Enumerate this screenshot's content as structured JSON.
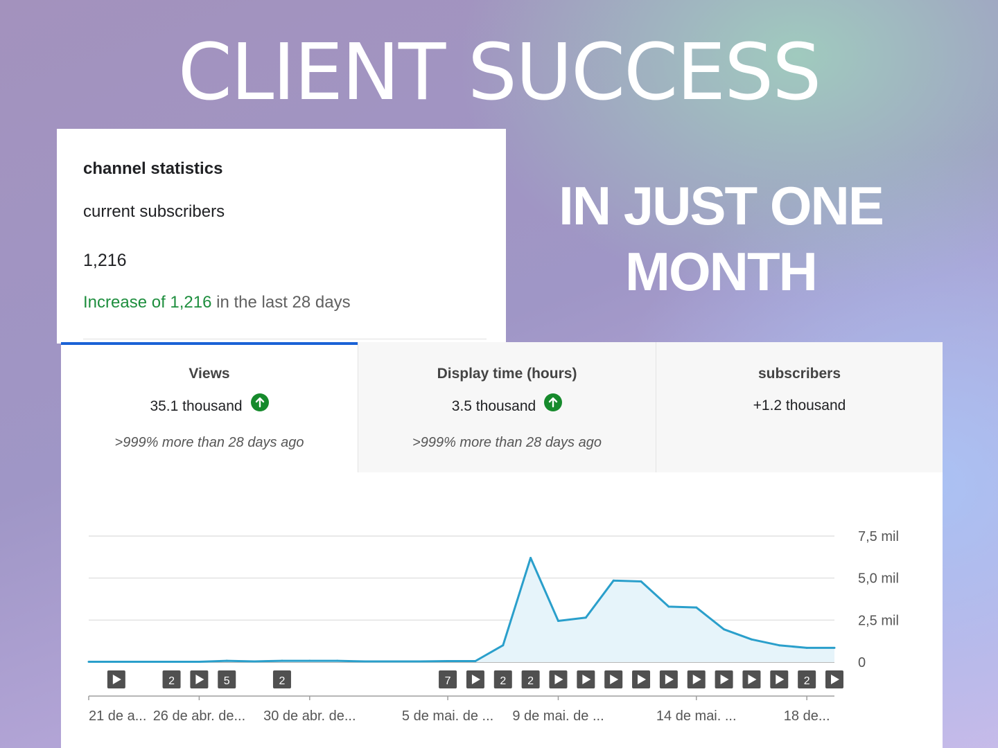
{
  "hero": {
    "title": "CLIENT SUCCESS",
    "subtitle_line1": "IN JUST ONE",
    "subtitle_line2": "MONTH"
  },
  "stats_card": {
    "heading": "channel statistics",
    "label": "current subscribers",
    "count": "1,216",
    "change_highlight": "Increase of 1,216",
    "change_rest": " in the last 28 days"
  },
  "tabs": [
    {
      "title": "Views",
      "value": "35.1 thousand",
      "trend_icon": "arrow-up-circle-icon",
      "note": ">999% more than 28 days ago"
    },
    {
      "title": "Display time (hours)",
      "value": "3.5 thousand",
      "trend_icon": "arrow-up-circle-icon",
      "note": ">999% more than 28 days ago"
    },
    {
      "title": "subscribers",
      "value": "+1.2 thousand"
    }
  ],
  "colors": {
    "accent": "#1a62d6",
    "positive": "#1e8e3e",
    "line": "#2a9fcb",
    "area": "#e6f4fa"
  },
  "chart_data": {
    "type": "area",
    "x": [
      "21 abr",
      "22 abr",
      "23 abr",
      "24 abr",
      "25 abr",
      "26 abr",
      "27 abr",
      "28 abr",
      "29 abr",
      "30 abr",
      "1 mai",
      "2 mai",
      "3 mai",
      "4 mai",
      "5 mai",
      "6 mai",
      "7 mai",
      "8 mai",
      "9 mai",
      "10 mai",
      "11 mai",
      "12 mai",
      "13 mai",
      "14 mai",
      "15 mai",
      "16 mai",
      "17 mai",
      "18 mai"
    ],
    "values": [
      20,
      20,
      20,
      20,
      20,
      80,
      40,
      80,
      80,
      80,
      40,
      40,
      40,
      60,
      60,
      1000,
      6200,
      2450,
      2650,
      4850,
      4800,
      3300,
      3250,
      1950,
      1350,
      1000,
      850,
      850
    ],
    "y_ticks": [
      "7,5 mil",
      "5,0 mil",
      "2,5 mil",
      "0"
    ],
    "y_tick_values": [
      7500,
      5000,
      2500,
      0
    ],
    "ylim": [
      0,
      7500
    ],
    "x_tick_labels": [
      {
        "index": 0,
        "label": "21 de a..."
      },
      {
        "index": 4,
        "label": "26 de abr. de..."
      },
      {
        "index": 8,
        "label": "30 de abr. de..."
      },
      {
        "index": 13,
        "label": "5 de mai. de ..."
      },
      {
        "index": 17,
        "label": "9 de mai. de ..."
      },
      {
        "index": 22,
        "label": "14 de mai. ..."
      },
      {
        "index": 26,
        "label": "18 de..."
      }
    ],
    "markers": [
      {
        "index": 1,
        "kind": "play"
      },
      {
        "index": 3,
        "kind": "count",
        "label": "2"
      },
      {
        "index": 4,
        "kind": "play"
      },
      {
        "index": 5,
        "kind": "count",
        "label": "5"
      },
      {
        "index": 7,
        "kind": "count",
        "label": "2"
      },
      {
        "index": 13,
        "kind": "count",
        "label": "7"
      },
      {
        "index": 14,
        "kind": "play"
      },
      {
        "index": 15,
        "kind": "count",
        "label": "2"
      },
      {
        "index": 16,
        "kind": "count",
        "label": "2"
      },
      {
        "index": 17,
        "kind": "play"
      },
      {
        "index": 18,
        "kind": "play"
      },
      {
        "index": 19,
        "kind": "play"
      },
      {
        "index": 20,
        "kind": "play"
      },
      {
        "index": 21,
        "kind": "play"
      },
      {
        "index": 22,
        "kind": "play"
      },
      {
        "index": 23,
        "kind": "play"
      },
      {
        "index": 24,
        "kind": "play"
      },
      {
        "index": 25,
        "kind": "play"
      },
      {
        "index": 26,
        "kind": "count",
        "label": "2"
      },
      {
        "index": 27,
        "kind": "play"
      }
    ],
    "grid": true
  }
}
